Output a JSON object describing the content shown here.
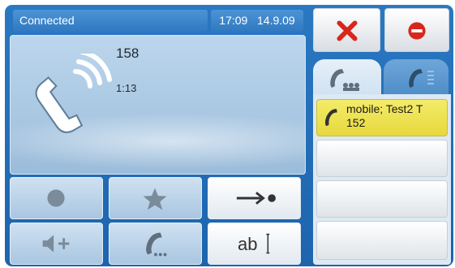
{
  "status": {
    "text": "Connected"
  },
  "clock": {
    "time": "17:09",
    "date": "14.9.09"
  },
  "call": {
    "number": "158",
    "duration": "1:13"
  },
  "buttons": {
    "hold": {
      "icon": "circle-icon"
    },
    "favorite": {
      "icon": "star-icon"
    },
    "transfer": {
      "icon": "arrow-dot-icon"
    },
    "volume_up": {
      "icon": "speaker-plus-icon"
    },
    "call_more": {
      "icon": "handset-dots-icon"
    },
    "text_input": {
      "label": "ab"
    },
    "end_call": {
      "icon": "close-icon",
      "color": "#d9261c"
    },
    "reject": {
      "icon": "minus-circle-icon",
      "color": "#d9261c"
    }
  },
  "tabs": [
    {
      "name": "active-calls",
      "icon": "handset-group-icon",
      "active": true
    },
    {
      "name": "phonebook",
      "icon": "handset-list-icon",
      "active": false
    }
  ],
  "call_list": [
    {
      "label": "mobile; Test2 T",
      "number": "152",
      "active": true
    },
    {
      "label": "",
      "number": "",
      "active": false
    },
    {
      "label": "",
      "number": "",
      "active": false
    },
    {
      "label": "",
      "number": "",
      "active": false
    }
  ],
  "colors": {
    "frame": "#1f66b0",
    "active_row": "#ece04f",
    "accent_red": "#d9261c"
  }
}
